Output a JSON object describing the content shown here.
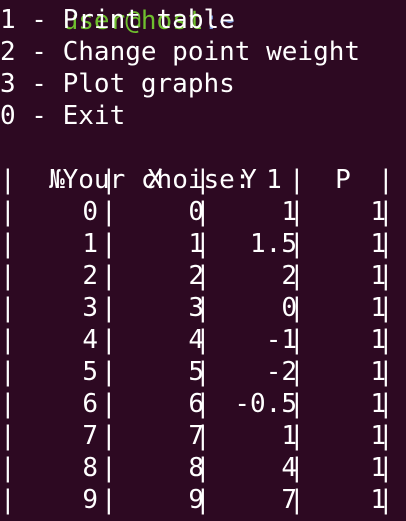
{
  "prompt_remnant": {
    "user_host": "user@host",
    "path": ":~"
  },
  "menu": {
    "item_1": "1 - Print table",
    "item_2": "2 - Change point weight",
    "item_3": "3 - Plot graphs",
    "item_0": "0 - Exit"
  },
  "input_prompt": {
    "label": "Your choise: ",
    "value": "1"
  },
  "table": {
    "bar": "|",
    "headers": [
      "№",
      "X",
      "Y",
      "P"
    ],
    "rows": [
      [
        "0",
        "0",
        "1",
        "1"
      ],
      [
        "1",
        "1",
        "1.5",
        "1"
      ],
      [
        "2",
        "2",
        "2",
        "1"
      ],
      [
        "3",
        "3",
        "0",
        "1"
      ],
      [
        "4",
        "4",
        "-1",
        "1"
      ],
      [
        "5",
        "5",
        "-2",
        "1"
      ],
      [
        "6",
        "6",
        "-0.5",
        "1"
      ],
      [
        "7",
        "7",
        "1",
        "1"
      ],
      [
        "8",
        "8",
        "4",
        "1"
      ],
      [
        "9",
        "9",
        "7",
        "1"
      ]
    ]
  },
  "colors": {
    "background": "#2d0922",
    "foreground": "#ffffff",
    "prompt_green": "#6fbf2e",
    "prompt_blue": "#6f8dd1"
  }
}
